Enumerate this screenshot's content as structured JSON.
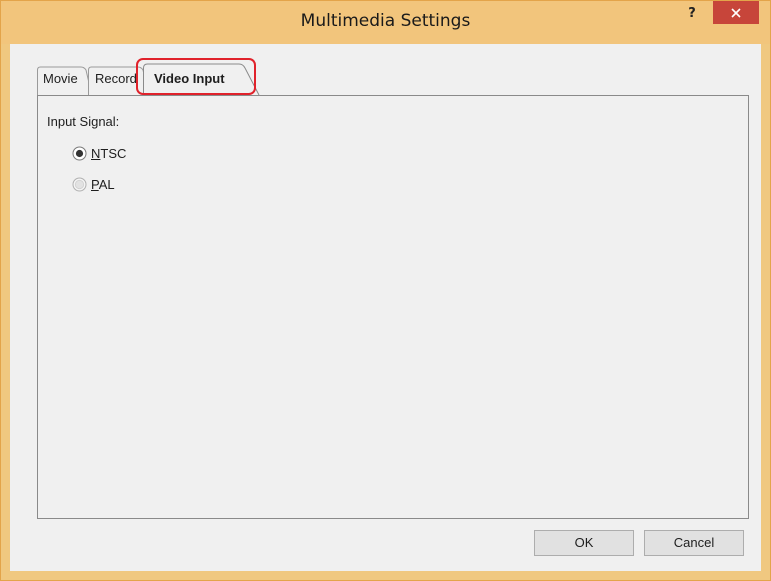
{
  "window": {
    "title": "Multimedia Settings",
    "help_label": "?",
    "close_icon": "close-icon"
  },
  "tabs": [
    {
      "label": "Movie",
      "selected": false
    },
    {
      "label": "Record",
      "selected": false
    },
    {
      "label": "Video Input",
      "selected": true
    }
  ],
  "video_input": {
    "group_label": "Input Signal:",
    "options": [
      {
        "label": "NTSC",
        "mnemonic": "N",
        "rest": "TSC",
        "checked": true
      },
      {
        "label": "PAL",
        "mnemonic": "P",
        "rest": "AL",
        "checked": false
      }
    ]
  },
  "buttons": {
    "ok_label": "OK",
    "cancel_label": "Cancel"
  },
  "colors": {
    "titlebar": "#f2c57c",
    "close_button": "#c7453a",
    "highlight": "#e0222b"
  }
}
